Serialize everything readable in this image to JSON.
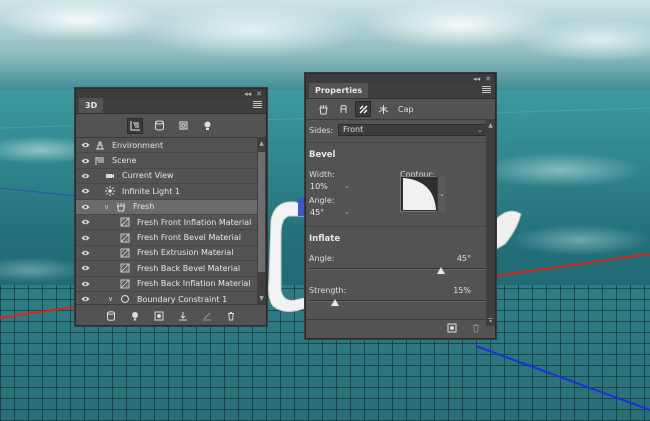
{
  "panel_3d": {
    "tab_label": "3D",
    "collapse_glyph": "◂◂",
    "close_glyph": "✕",
    "toolbar_icons": [
      "whole-scene-filter-icon",
      "meshes-filter-icon",
      "materials-filter-icon",
      "lights-filter-icon"
    ],
    "rows": [
      {
        "label": "Environment",
        "icon": "environment-icon",
        "indent": 0,
        "selected": false
      },
      {
        "label": "Scene",
        "icon": "scene-icon",
        "indent": 0,
        "selected": false
      },
      {
        "label": "Current View",
        "icon": "camera-icon",
        "indent": 1,
        "selected": false
      },
      {
        "label": "Infinite Light 1",
        "icon": "infinite-light-icon",
        "indent": 1,
        "selected": false
      },
      {
        "label": "Fresh",
        "icon": "mesh-icon",
        "indent": 1,
        "selected": true,
        "expanded": true
      },
      {
        "label": "Fresh Front Inflation Material",
        "icon": "material-icon",
        "indent": 2,
        "selected": false
      },
      {
        "label": "Fresh Front Bevel Material",
        "icon": "material-icon",
        "indent": 2,
        "selected": false
      },
      {
        "label": "Fresh Extrusion Material",
        "icon": "material-icon",
        "indent": 2,
        "selected": false
      },
      {
        "label": "Fresh Back Bevel Material",
        "icon": "material-icon",
        "indent": 2,
        "selected": false
      },
      {
        "label": "Fresh Back Inflation Material",
        "icon": "material-icon",
        "indent": 2,
        "selected": false
      },
      {
        "label": "Boundary Constraint 1",
        "icon": "constraint-icon",
        "indent": 2,
        "selected": false,
        "expanded": true
      }
    ],
    "footer_icons": [
      "add-mesh-icon",
      "add-light-icon",
      "render-icon",
      "drop-to-ground-icon",
      "constraint-add-icon",
      "trash-icon"
    ]
  },
  "panel_properties": {
    "tab_label": "Properties",
    "collapse_glyph": "◂◂",
    "close_glyph": "✕",
    "toolbar_icons": [
      "mesh-prop-icon",
      "deform-prop-icon",
      "cap-prop-icon",
      "coordinates-prop-icon"
    ],
    "cap_label": "Cap",
    "sides_label": "Sides:",
    "sides_value": "Front",
    "bevel_title": "Bevel",
    "width_label": "Width:",
    "width_value": "10%",
    "contour_label": "Contour:",
    "angle_label": "Angle:",
    "bevel_angle_value": "45°",
    "inflate_title": "Inflate",
    "inflate_angle_label": "Angle:",
    "inflate_angle_value": "45°",
    "inflate_angle_fraction": 0.75,
    "strength_label": "Strength:",
    "strength_value": "15%",
    "strength_fraction": 0.15,
    "footer_icons": [
      "reset-deformation-icon",
      "trash-icon"
    ]
  },
  "colors": {
    "panel_bg": "#535353",
    "selected_row": "#6b6b6b",
    "axis_red": "#e0201a",
    "axis_blue": "#1a30e0"
  }
}
